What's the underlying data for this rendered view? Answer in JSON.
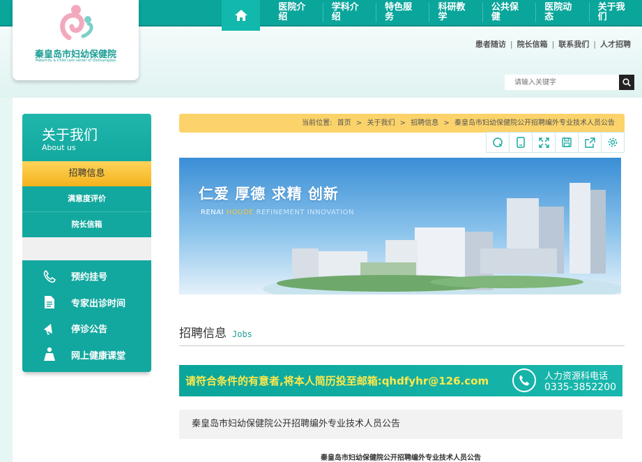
{
  "header": {
    "logo_name": "秦皇岛市妇幼保健院",
    "logo_en": "Maternity & Child care center of Qinhuangdao",
    "nav": [
      "医院介绍",
      "学科介绍",
      "特色服务",
      "科研教学",
      "公共保健",
      "医院动态",
      "关于我们"
    ],
    "toplinks": [
      "患者随访",
      "院长信箱",
      "联系我们",
      "人才招聘"
    ],
    "search_placeholder": "请输入关键字",
    "colors": {
      "brand": "#0aa59b",
      "accent": "#f4b21c"
    }
  },
  "sidebar": {
    "title": "关于我们",
    "title_en": "About us",
    "active": "招聘信息",
    "subitems": [
      "满意度评价",
      "院长信箱"
    ],
    "quick": [
      {
        "label": "预约挂号",
        "icon": "phone-icon"
      },
      {
        "label": "专家出诊时间",
        "icon": "document-icon"
      },
      {
        "label": "停诊公告",
        "icon": "megaphone-icon"
      },
      {
        "label": "网上健康课堂",
        "icon": "person-icon"
      }
    ]
  },
  "breadcrumb": {
    "prefix": "当前位置:",
    "items": [
      "首页",
      "关于我们",
      "招聘信息",
      "秦皇岛市妇幼保健院公开招聘编外专业技术人员公告"
    ],
    "separator": ">"
  },
  "tools": [
    "search-icon",
    "mobile-icon",
    "fullscreen-icon",
    "save-icon",
    "share-icon",
    "settings-icon"
  ],
  "banner": {
    "slogan": "仁爱 厚德 求精 创新",
    "slogan_en": [
      "RENAI",
      "HOUDE",
      "REFINEMENT",
      "INNOVATION"
    ]
  },
  "section": {
    "title": "招聘信息",
    "title_en": "Jobs"
  },
  "notice": {
    "message": "请符合条件的有意者,将本人简历投至邮箱:qhdfyhr@126.com",
    "phone_title": "人力资源科电话",
    "phone_number": "0335-3852200"
  },
  "article": {
    "title": "秦皇岛市妇幼保健院公开招聘编外专业技术人员公告",
    "subtitle": "秦皇岛市妇幼保健院公开招聘编外专业技术人员公告"
  }
}
